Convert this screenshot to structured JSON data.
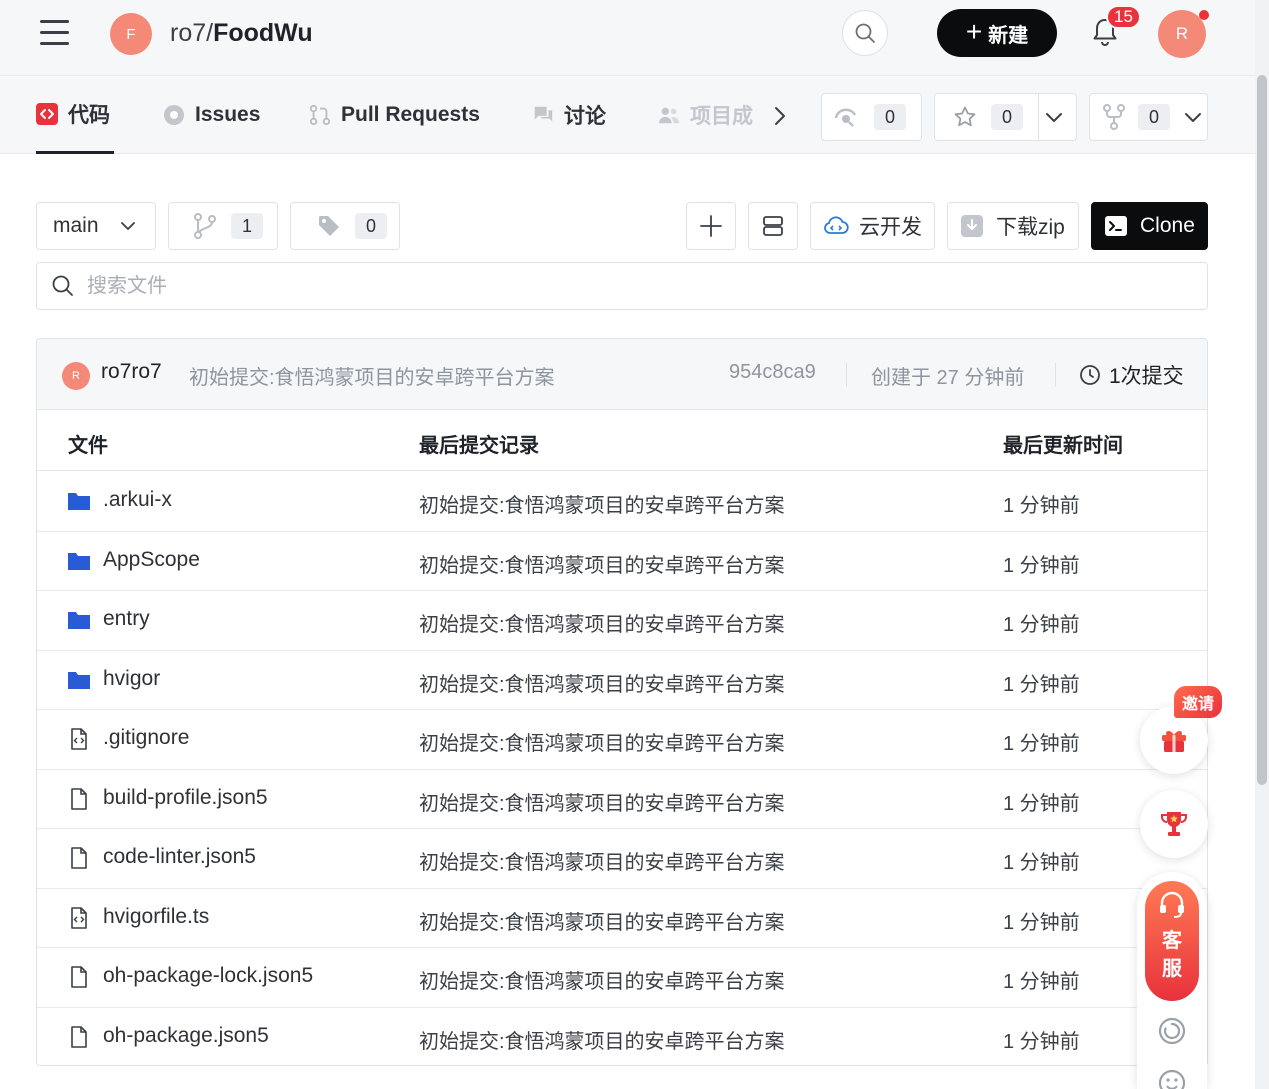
{
  "header": {
    "repo_avatar_initial": "F",
    "repo_owner": "ro7/",
    "repo_name": "FoodWu",
    "new_label": "新建",
    "notification_count": "15",
    "user_initial": "R"
  },
  "tabs": [
    {
      "label": "代码",
      "icon": "code-icon",
      "active": true
    },
    {
      "label": "Issues",
      "icon": "issue-icon"
    },
    {
      "label": "Pull Requests",
      "icon": "pull-request-icon"
    },
    {
      "label": "讨论",
      "icon": "discussion-icon"
    },
    {
      "label": "项目成",
      "icon": "members-icon"
    }
  ],
  "repo_stats": {
    "watch_count": "0",
    "star_count": "0",
    "fork_count": "0"
  },
  "toolbar": {
    "branch": "main",
    "branch_count": "1",
    "tag_count": "0",
    "cloud_dev_label": "云开发",
    "download_zip_label": "下载zip",
    "clone_label": "Clone",
    "search_placeholder": "搜索文件"
  },
  "commit": {
    "avatar_initial": "R",
    "author": "ro7ro7",
    "message": "初始提交:食悟鸿蒙项目的安卓跨平台方案",
    "hash": "954c8ca9",
    "created": "创建于 27 分钟前",
    "count_label": "1次提交"
  },
  "table_headers": {
    "file": "文件",
    "last_commit": "最后提交记录",
    "last_updated": "最后更新时间"
  },
  "files": [
    {
      "name": ".arkui-x",
      "type": "folder",
      "message": "初始提交:食悟鸿蒙项目的安卓跨平台方案",
      "time": "1 分钟前"
    },
    {
      "name": "AppScope",
      "type": "folder",
      "message": "初始提交:食悟鸿蒙项目的安卓跨平台方案",
      "time": "1 分钟前"
    },
    {
      "name": "entry",
      "type": "folder",
      "message": "初始提交:食悟鸿蒙项目的安卓跨平台方案",
      "time": "1 分钟前"
    },
    {
      "name": "hvigor",
      "type": "folder",
      "message": "初始提交:食悟鸿蒙项目的安卓跨平台方案",
      "time": "1 分钟前"
    },
    {
      "name": ".gitignore",
      "type": "code",
      "message": "初始提交:食悟鸿蒙项目的安卓跨平台方案",
      "time": "1 分钟前"
    },
    {
      "name": "build-profile.json5",
      "type": "file",
      "message": "初始提交:食悟鸿蒙项目的安卓跨平台方案",
      "time": "1 分钟前"
    },
    {
      "name": "code-linter.json5",
      "type": "file",
      "message": "初始提交:食悟鸿蒙项目的安卓跨平台方案",
      "time": "1 分钟前"
    },
    {
      "name": "hvigorfile.ts",
      "type": "code",
      "message": "初始提交:食悟鸿蒙项目的安卓跨平台方案",
      "time": "1 分钟前"
    },
    {
      "name": "oh-package-lock.json5",
      "type": "file",
      "message": "初始提交:食悟鸿蒙项目的安卓跨平台方案",
      "time": "1 分钟前"
    },
    {
      "name": "oh-package.json5",
      "type": "file",
      "message": "初始提交:食悟鸿蒙项目的安卓跨平台方案",
      "time": "1 分钟前"
    }
  ],
  "floating": {
    "invite_label": "邀请",
    "customer_service_label": "客服"
  },
  "colors": {
    "accent_red": "#e8323c",
    "avatar": "#f58978",
    "folder_blue": "#2a5bd7",
    "dark_button": "#0b0c0e"
  }
}
